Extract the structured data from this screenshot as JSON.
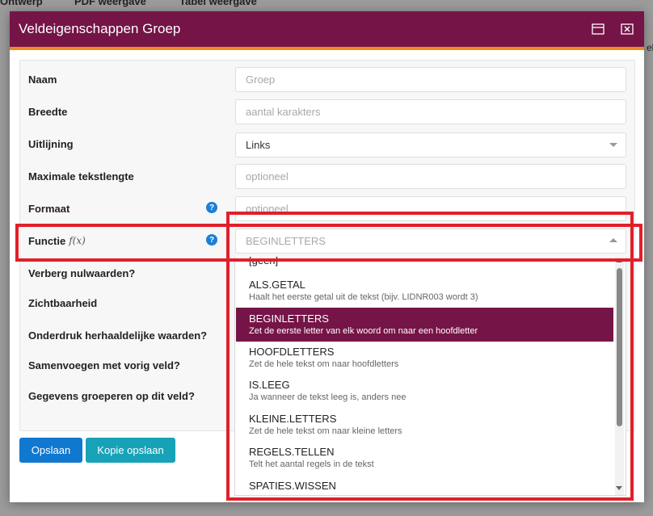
{
  "background": {
    "tabs": [
      "Ontwerp",
      "PDF weergave",
      "Tabel weergave"
    ],
    "side_text": "elo"
  },
  "modal": {
    "title": "Veldeigenschappen Groep",
    "colors": {
      "header": "#751447",
      "accent": "#f08a1c"
    }
  },
  "form": {
    "naam": {
      "label": "Naam",
      "placeholder": "Groep"
    },
    "breedte": {
      "label": "Breedte",
      "placeholder": "aantal karakters"
    },
    "uitlijning": {
      "label": "Uitlijning",
      "value": "Links"
    },
    "max_len": {
      "label": "Maximale tekstlengte",
      "placeholder": "optioneel"
    },
    "formaat": {
      "label": "Formaat",
      "placeholder": "optioneel",
      "help": "?"
    },
    "functie": {
      "label": "Functie",
      "fx": "f(x)",
      "value": "BEGINLETTERS",
      "help": "?"
    },
    "verberg": {
      "label": "Verberg nulwaarden?"
    },
    "zichtbaarheid": {
      "label": "Zichtbaarheid"
    },
    "onderdruk": {
      "label": "Onderdruk herhaaldelijke waarden?"
    },
    "samenvoegen": {
      "label": "Samenvoegen met vorig veld?"
    },
    "groeperen": {
      "label": "Gegevens groeperen op dit veld?"
    }
  },
  "buttons": {
    "save": "Opslaan",
    "copy_save": "Kopie opslaan"
  },
  "dropdown": {
    "items": [
      {
        "title": "[geen]",
        "desc": ""
      },
      {
        "title": "ALS.GETAL",
        "desc": "Haalt het eerste getal uit de tekst (bijv. LIDNR003 wordt 3)"
      },
      {
        "title": "BEGINLETTERS",
        "desc": "Zet de eerste letter van elk woord om naar een hoofdletter"
      },
      {
        "title": "HOOFDLETTERS",
        "desc": "Zet de hele tekst om naar hoofdletters"
      },
      {
        "title": "IS.LEEG",
        "desc": "Ja wanneer de tekst leeg is, anders nee"
      },
      {
        "title": "KLEINE.LETTERS",
        "desc": "Zet de hele tekst om naar kleine letters"
      },
      {
        "title": "REGELS.TELLEN",
        "desc": "Telt het aantal regels in de tekst"
      },
      {
        "title": "SPATIES.WISSEN",
        "desc": ""
      }
    ]
  },
  "icons": {
    "maximize": "maximize-icon",
    "close": "close-icon",
    "help": "help-icon",
    "caret": "chevron-icon"
  },
  "annotation_color": "#e0202a"
}
